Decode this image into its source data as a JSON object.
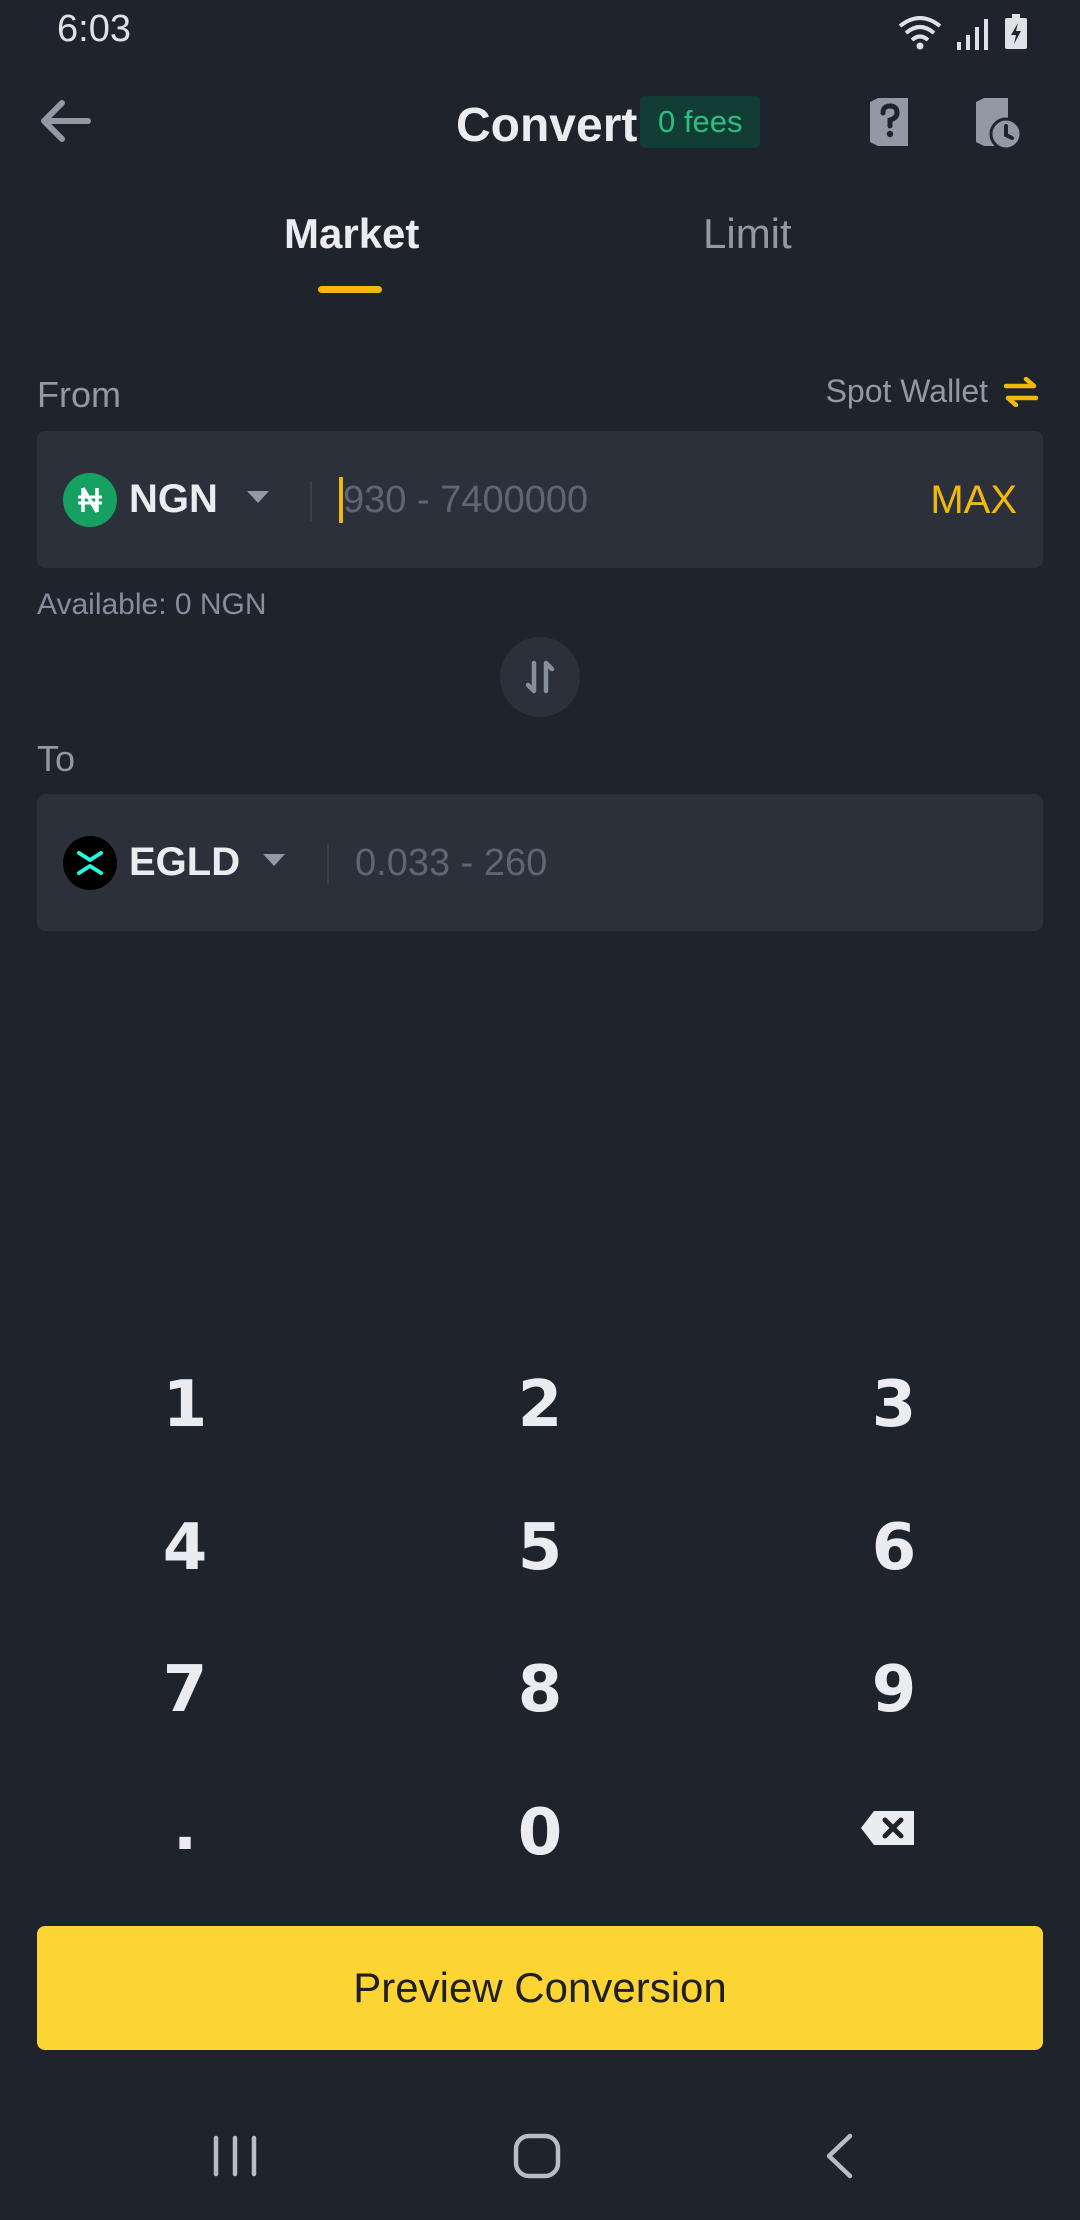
{
  "status_bar": {
    "time": "6:03"
  },
  "header": {
    "title": "Convert",
    "badge": "0 fees"
  },
  "tabs": [
    {
      "label": "Market",
      "active": true
    },
    {
      "label": "Limit",
      "active": false
    }
  ],
  "from": {
    "label": "From",
    "wallet": "Spot Wallet",
    "asset": "NGN",
    "placeholder": "930 - 7400000",
    "max": "MAX",
    "available": "Available: 0 NGN"
  },
  "to": {
    "label": "To",
    "asset": "EGLD",
    "placeholder": "0.033 - 260"
  },
  "keypad": {
    "k1": "1",
    "k2": "2",
    "k3": "3",
    "k4": "4",
    "k5": "5",
    "k6": "6",
    "k7": "7",
    "k8": "8",
    "k9": "9",
    "kdot": ".",
    "k0": "0"
  },
  "preview_button": "Preview Conversion",
  "colors": {
    "background": "#1f232b",
    "field": "#2b303a",
    "accent": "#f0b90b",
    "button": "#fcd535",
    "badge_text": "#2ebd85",
    "ngn_icon": "#16a163"
  },
  "icons": [
    "wifi-icon",
    "signal-icon",
    "battery-icon",
    "back-arrow-icon",
    "help-icon",
    "history-icon",
    "transfer-icon",
    "swap-icon",
    "backspace-icon"
  ]
}
